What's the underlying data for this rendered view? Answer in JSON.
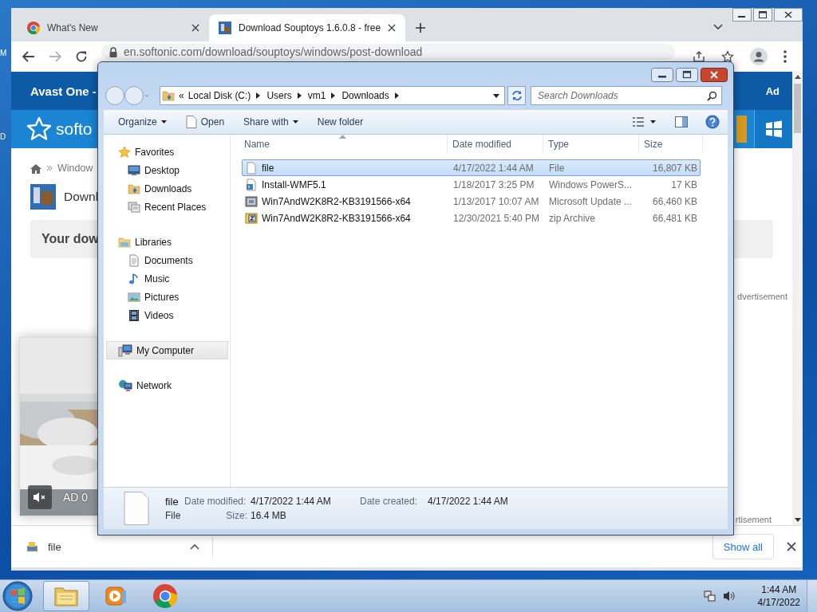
{
  "desktop": {
    "icon_labels": [
      "M",
      "D"
    ]
  },
  "browser": {
    "tabs": [
      {
        "title": "What's New",
        "kind": "chrome",
        "selected": false
      },
      {
        "title": "Download Souptoys 1.6.0.8 - free",
        "kind": "site",
        "selected": true
      }
    ],
    "nav_buttons": [
      {
        "kind": "back",
        "disabled": false
      },
      {
        "kind": "forward",
        "disabled": true
      },
      {
        "kind": "reload",
        "disabled": false
      }
    ],
    "address": "en.softonic.com/download/souptoys/windows/post-download",
    "page": {
      "ad_banner": "Avast One -",
      "ad_label": "Ad",
      "logo": "softo",
      "breadcrumb": "Window",
      "title": "Downl",
      "notice": "Your dow",
      "advertisement_top": "dvertisement",
      "video_ad_label": "AD 0",
      "advertisement_bottom": "rtisement"
    },
    "download_bar": {
      "file": "file",
      "show_all": "Show all"
    }
  },
  "explorer": {
    "path": [
      "«",
      "Local Disk (C:)",
      "Users",
      "vm1",
      "Downloads"
    ],
    "search": {
      "placeholder": "Search Downloads"
    },
    "toolbar": [
      {
        "label": "Organize",
        "kind": "menu"
      },
      {
        "label": "Open",
        "kind": "open"
      },
      {
        "label": "Share with",
        "kind": "menu"
      },
      {
        "label": "New folder",
        "kind": "plain"
      }
    ],
    "nav": [
      {
        "label": "Favorites",
        "kind": "star",
        "selected": false,
        "children": [
          {
            "label": "Desktop",
            "kind": "desktop",
            "selected": false
          },
          {
            "label": "Downloads",
            "kind": "downloads",
            "selected": false
          },
          {
            "label": "Recent Places",
            "kind": "recent",
            "selected": false
          }
        ]
      },
      {
        "label": "Libraries",
        "kind": "libraries",
        "selected": false,
        "children": [
          {
            "label": "Documents",
            "kind": "documents",
            "selected": false
          },
          {
            "label": "Music",
            "kind": "music",
            "selected": false
          },
          {
            "label": "Pictures",
            "kind": "pictures",
            "selected": false
          },
          {
            "label": "Videos",
            "kind": "videos",
            "selected": false
          }
        ]
      },
      {
        "label": "My Computer",
        "kind": "computer",
        "selected": true
      },
      {
        "label": "Network",
        "kind": "network",
        "selected": false
      }
    ],
    "columns": [
      {
        "label": "Name",
        "sorted": true
      },
      {
        "label": "Date modified",
        "sorted": false
      },
      {
        "label": "Type",
        "sorted": false
      },
      {
        "label": "Size",
        "sorted": false
      }
    ],
    "rows": [
      {
        "name": "file",
        "date": "4/17/2022 1:44 AM",
        "type": "File",
        "size": "16,807 KB",
        "kind": "blank",
        "selected": true
      },
      {
        "name": "Install-WMF5.1",
        "date": "1/18/2017 3:25 PM",
        "type": "Windows PowerS...",
        "size": "17 KB",
        "kind": "script",
        "selected": false
      },
      {
        "name": "Win7AndW2K8R2-KB3191566-x64",
        "date": "1/13/2017 10:07 AM",
        "type": "Microsoft Update ...",
        "size": "66,460 KB",
        "kind": "update",
        "selected": false
      },
      {
        "name": "Win7AndW2K8R2-KB3191566-x64",
        "date": "12/30/2021 5:40 PM",
        "type": "zip Archive",
        "size": "66,481 KB",
        "kind": "zip",
        "selected": false
      }
    ],
    "details": {
      "name": "file",
      "type": "File",
      "modified_label": "Date modified:",
      "modified": "4/17/2022 1:44 AM",
      "created_label": "Date created:",
      "created": "4/17/2022 1:44 AM",
      "size_label": "Size:",
      "size": "16.4 MB"
    }
  },
  "taskbar": {
    "apps": [
      {
        "kind": "explorer",
        "selected": true
      },
      {
        "kind": "media",
        "selected": false
      },
      {
        "kind": "chrome",
        "selected": false
      }
    ],
    "time": "1:44 AM",
    "date": "4/17/2022"
  }
}
